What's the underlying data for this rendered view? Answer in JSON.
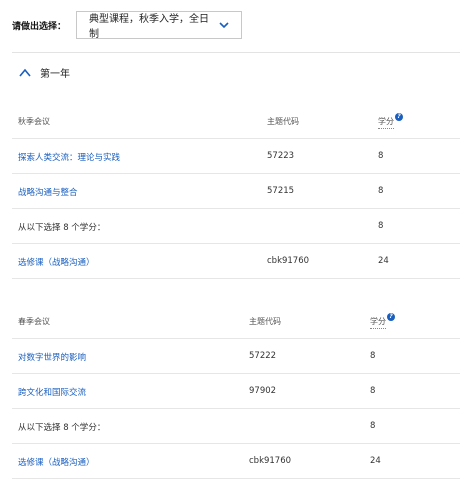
{
  "selector": {
    "label": "请做出选择：",
    "value": "典型课程，秋季入学，全日制"
  },
  "year": {
    "title": "第一年"
  },
  "semesters": [
    {
      "name": "秋季会议",
      "code_header": "主题代码",
      "credit_header": "学分",
      "rows": [
        {
          "title": "探索人类交流：理论与实践",
          "code": "57223",
          "credits": "8",
          "link": true
        },
        {
          "title": "战略沟通与整合",
          "code": "57215",
          "credits": "8",
          "link": true
        },
        {
          "title": "从以下选择 8 个学分：",
          "code": "",
          "credits": "8",
          "link": false
        },
        {
          "title": "选修课（战略沟通）",
          "code": "cbk91760",
          "credits": "24",
          "link": true
        }
      ]
    },
    {
      "name": "春季会议",
      "code_header": "主题代码",
      "credit_header": "学分",
      "rows": [
        {
          "title": "对数字世界的影响",
          "code": "57222",
          "credits": "8",
          "link": true
        },
        {
          "title": "跨文化和国际交流",
          "code": "97902",
          "credits": "8",
          "link": true
        },
        {
          "title": "从以下选择 8 个学分：",
          "code": "",
          "credits": "8",
          "link": false
        },
        {
          "title": "选修课（战略沟通）",
          "code": "cbk91760",
          "credits": "24",
          "link": true
        }
      ]
    }
  ],
  "colors": {
    "link": "#1a5fbf",
    "divider": "#e6e6e6"
  }
}
